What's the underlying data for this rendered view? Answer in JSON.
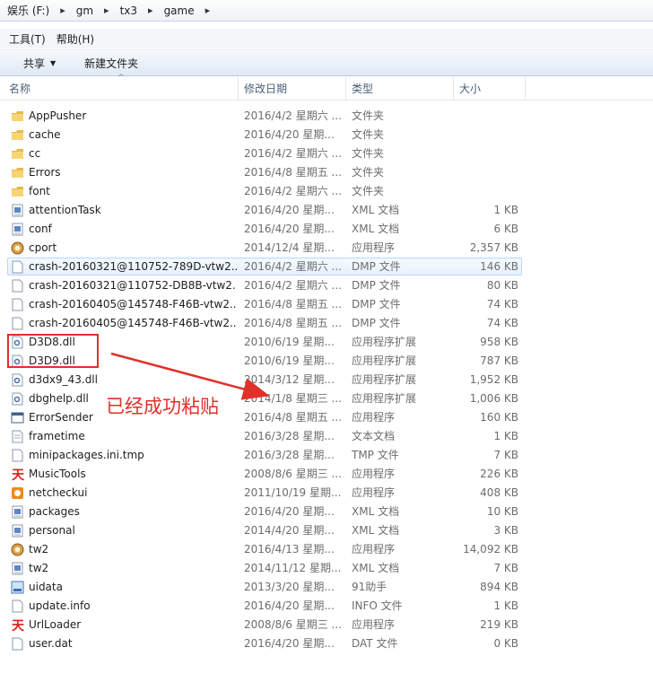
{
  "address": {
    "crumbs": [
      "娱乐 (F:)",
      "gm",
      "tx3",
      "game"
    ]
  },
  "menu": {
    "items": [
      "工具(T)",
      "帮助(H)"
    ]
  },
  "toolbar": {
    "share_label": "共享",
    "new_folder_label": "新建文件夹"
  },
  "columns": {
    "name": "名称",
    "date": "修改日期",
    "type": "类型",
    "size": "大小"
  },
  "files": [
    {
      "name": "AppPusher",
      "date": "2016/4/2 星期六 ...",
      "type": "文件夹",
      "size": "",
      "icon": "folder-icon"
    },
    {
      "name": "cache",
      "date": "2016/4/20 星期...",
      "type": "文件夹",
      "size": "",
      "icon": "folder-icon"
    },
    {
      "name": "cc",
      "date": "2016/4/2 星期六 ...",
      "type": "文件夹",
      "size": "",
      "icon": "folder-icon"
    },
    {
      "name": "Errors",
      "date": "2016/4/8 星期五 ...",
      "type": "文件夹",
      "size": "",
      "icon": "folder-icon"
    },
    {
      "name": "font",
      "date": "2016/4/2 星期六 ...",
      "type": "文件夹",
      "size": "",
      "icon": "folder-icon"
    },
    {
      "name": "attentionTask",
      "date": "2016/4/20 星期...",
      "type": "XML 文档",
      "size": "1 KB",
      "icon": "xml-file-icon"
    },
    {
      "name": "conf",
      "date": "2016/4/20 星期...",
      "type": "XML 文档",
      "size": "6 KB",
      "icon": "xml-file-icon"
    },
    {
      "name": "cport",
      "date": "2014/12/4 星期...",
      "type": "应用程序",
      "size": "2,357 KB",
      "icon": "app-icon"
    },
    {
      "name": "crash-20160321@110752-789D-vtw2...",
      "date": "2016/4/2 星期六 ...",
      "type": "DMP 文件",
      "size": "146 KB",
      "icon": "blank-file-icon",
      "selected": true
    },
    {
      "name": "crash-20160321@110752-DB8B-vtw2...",
      "date": "2016/4/2 星期六 ...",
      "type": "DMP 文件",
      "size": "80 KB",
      "icon": "blank-file-icon"
    },
    {
      "name": "crash-20160405@145748-F46B-vtw2...",
      "date": "2016/4/8 星期五 ...",
      "type": "DMP 文件",
      "size": "74 KB",
      "icon": "blank-file-icon"
    },
    {
      "name": "crash-20160405@145748-F46B-vtw2...",
      "date": "2016/4/8 星期五 ...",
      "type": "DMP 文件",
      "size": "74 KB",
      "icon": "blank-file-icon"
    },
    {
      "name": "D3D8.dll",
      "date": "2010/6/19 星期...",
      "type": "应用程序扩展",
      "size": "958 KB",
      "icon": "dll-file-icon"
    },
    {
      "name": "D3D9.dll",
      "date": "2010/6/19 星期...",
      "type": "应用程序扩展",
      "size": "787 KB",
      "icon": "dll-file-icon"
    },
    {
      "name": "d3dx9_43.dll",
      "date": "2014/3/12 星期...",
      "type": "应用程序扩展",
      "size": "1,952 KB",
      "icon": "dll-file-icon"
    },
    {
      "name": "dbghelp.dll",
      "date": "2014/1/8 星期三 ...",
      "type": "应用程序扩展",
      "size": "1,006 KB",
      "icon": "dll-file-icon"
    },
    {
      "name": "ErrorSender",
      "date": "2016/4/8 星期五 ...",
      "type": "应用程序",
      "size": "160 KB",
      "icon": "window-app-icon"
    },
    {
      "name": "frametime",
      "date": "2016/3/28 星期...",
      "type": "文本文档",
      "size": "1 KB",
      "icon": "text-file-icon"
    },
    {
      "name": "minipackages.ini.tmp",
      "date": "2016/3/28 星期...",
      "type": "TMP 文件",
      "size": "7 KB",
      "icon": "blank-file-icon"
    },
    {
      "name": "MusicTools",
      "date": "2008/8/6 星期三 ...",
      "type": "应用程序",
      "size": "226 KB",
      "icon": "red-tian-icon"
    },
    {
      "name": "netcheckui",
      "date": "2011/10/19 星期...",
      "type": "应用程序",
      "size": "408 KB",
      "icon": "orange-app-icon"
    },
    {
      "name": "packages",
      "date": "2016/4/20 星期...",
      "type": "XML 文档",
      "size": "10 KB",
      "icon": "xml-file-icon"
    },
    {
      "name": "personal",
      "date": "2014/4/20 星期...",
      "type": "XML 文档",
      "size": "3 KB",
      "icon": "xml-file-icon"
    },
    {
      "name": "tw2",
      "date": "2016/4/13 星期...",
      "type": "应用程序",
      "size": "14,092 KB",
      "icon": "app-icon"
    },
    {
      "name": "tw2",
      "date": "2014/11/12 星期...",
      "type": "XML 文档",
      "size": "7 KB",
      "icon": "xml-file-icon"
    },
    {
      "name": "uidata",
      "date": "2013/3/20 星期...",
      "type": "91助手",
      "size": "894 KB",
      "icon": "pxl-file-icon"
    },
    {
      "name": "update.info",
      "date": "2016/4/20 星期...",
      "type": "INFO 文件",
      "size": "1 KB",
      "icon": "blank-file-icon"
    },
    {
      "name": "UrlLoader",
      "date": "2008/8/6 星期三 ...",
      "type": "应用程序",
      "size": "219 KB",
      "icon": "red-tian-icon"
    },
    {
      "name": "user.dat",
      "date": "2016/4/20 星期...",
      "type": "DAT 文件",
      "size": "0 KB",
      "icon": "blank-file-icon"
    }
  ],
  "annotation": {
    "text": "已经成功粘贴",
    "color": "#e0302a"
  }
}
